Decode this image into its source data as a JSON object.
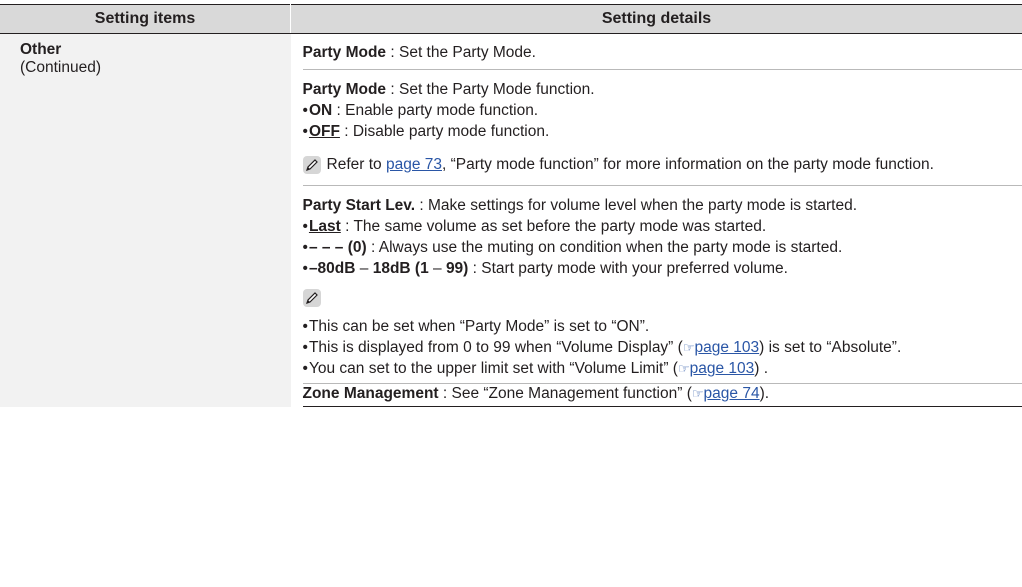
{
  "header": {
    "col1": "Setting items",
    "col2": "Setting details"
  },
  "item": {
    "title": "Other",
    "subtitle": "(Continued)"
  },
  "party_mode_menu": {
    "label": "Party Mode",
    "desc": " : Set the Party Mode."
  },
  "party_mode": {
    "label": "Party Mode",
    "desc": " : Set the Party Mode function.",
    "on_label": "ON",
    "on_desc": " : Enable party mode function.",
    "off_label": "OFF",
    "off_desc": " : Disable party mode function.",
    "note_pre": "Refer to ",
    "note_link": "page 73",
    "note_post": ", “Party mode function” for more information on the party mode function."
  },
  "party_start": {
    "label": "Party Start Lev.",
    "desc": " : Make settings for volume level when the party mode is started.",
    "last_label": "Last",
    "last_desc": " : The same volume as set before the party mode was started.",
    "zero_label": "– – – (0)",
    "zero_desc": " : Always use the muting on condition when the party mode is started.",
    "range_a": "–80dB",
    "range_dash": " – ",
    "range_b": "18dB (1",
    "range_dash2": " – ",
    "range_c": "99)",
    "range_desc": " : Start party mode with your preferred volume.",
    "notes": {
      "n1": "This can be set when “Party Mode” is set to “ON”.",
      "n2_pre": "This is displayed from 0 to 99 when “Volume Display” (",
      "n2_link": "page 103",
      "n2_post": ") is set to “Absolute”.",
      "n3_pre": "You can set to the upper limit set with “Volume Limit” (",
      "n3_link": "page 103",
      "n3_post": ") ."
    }
  },
  "zone": {
    "label": "Zone Management",
    "desc": " : See “Zone Management function” (",
    "link": "page 74",
    "post": ")."
  },
  "icons": {
    "pencil": "pencil-icon",
    "ref": "page-ref-icon"
  },
  "colors": {
    "header_bg": "#d9d9d9",
    "item_bg": "#f2f2f2",
    "link": "#2a56a6"
  }
}
